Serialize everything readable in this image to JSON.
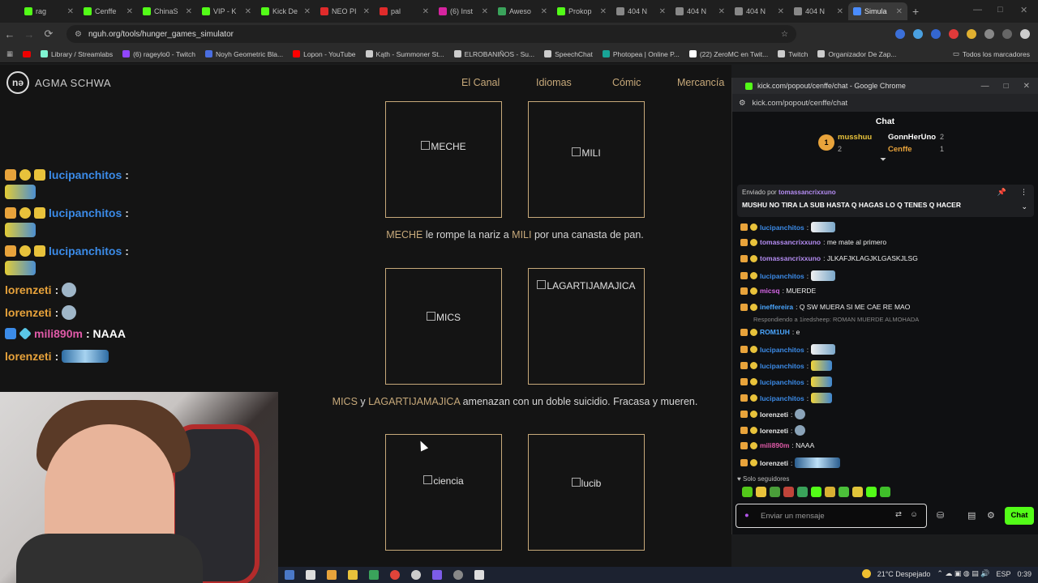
{
  "tabs": [
    {
      "title": "rag",
      "color": "#53fc18"
    },
    {
      "title": "Cenffe",
      "color": "#53fc18"
    },
    {
      "title": "ChinaS",
      "color": "#53fc18"
    },
    {
      "title": "VIP - K",
      "color": "#53fc18"
    },
    {
      "title": "Kick De",
      "color": "#53fc18"
    },
    {
      "title": "NEO PI",
      "color": "#e02b2b"
    },
    {
      "title": "pal",
      "color": "#e02b2b"
    },
    {
      "title": "(6) Inst",
      "color": "#d6249f"
    },
    {
      "title": "Aweso",
      "color": "#3aa35b"
    },
    {
      "title": "Prokop",
      "color": "#53fc18"
    },
    {
      "title": "404 N",
      "color": "#888"
    },
    {
      "title": "404 N",
      "color": "#888"
    },
    {
      "title": "404 N",
      "color": "#888"
    },
    {
      "title": "404 N",
      "color": "#888"
    },
    {
      "title": "Simula",
      "color": "#4a8cff"
    }
  ],
  "address": {
    "url": "nguh.org/tools/hunger_games_simulator"
  },
  "bookmarks": [
    {
      "label": "Library / Streamlabs",
      "color": "#80f5d2"
    },
    {
      "label": "(6) rageylo0 - Twitch",
      "color": "#9146ff"
    },
    {
      "label": "Noyh Geometric Bla...",
      "color": "#4a6ee0"
    },
    {
      "label": "Lopon - YouTube",
      "color": "#ff0000"
    },
    {
      "label": "Kąth - Summoner St...",
      "color": "#cccccc"
    },
    {
      "label": "ELROBANIÑOS - Su...",
      "color": "#cccccc"
    },
    {
      "label": "SpeechChat",
      "color": "#cccccc"
    },
    {
      "label": "Photopea | Online P...",
      "color": "#18a497"
    },
    {
      "label": "(22) ZeroMC en Twit...",
      "color": "#ffffff"
    },
    {
      "label": "Twitch",
      "color": "#cccccc"
    },
    {
      "label": "Organizador De Zap...",
      "color": "#cccccc"
    }
  ],
  "all_bookmarks": "Todos los marcadores",
  "site": {
    "logo": "nə",
    "brand": "AGMA SCHWA",
    "nav": [
      "El Canal",
      "Idiomas",
      "Cómic",
      "Mercancía"
    ],
    "cards": [
      "MECHE",
      "MILI",
      "MICS",
      "LAGARTIJAMAJICA",
      "ciencia",
      "lucib"
    ],
    "events": [
      {
        "a": "MECHE",
        "mid": " le rompe la nariz a ",
        "b": "MILI",
        "end": " por una canasta de pan."
      },
      {
        "a": "MICS",
        "mid": " y ",
        "b": "LAGARTIJAMAJICA",
        "end": " amenazan con un doble suicidio. Fracasa y mueren."
      }
    ]
  },
  "overlay_chat": [
    {
      "user": "lucipanchitos",
      "color": "#3b8be8",
      "text": ":"
    },
    {
      "user": "lucipanchitos",
      "color": "#3b8be8",
      "text": ":"
    },
    {
      "user": "lucipanchitos",
      "color": "#3b8be8",
      "text": ":"
    },
    {
      "user": "lorenzeti",
      "color": "#e8a33b",
      "text": ":"
    },
    {
      "user": "lorenzeti",
      "color": "#e8a33b",
      "text": ":"
    },
    {
      "user": "mili890m",
      "color": "#e05aa8",
      "text": ": NAAA"
    },
    {
      "user": "lorenzeti",
      "color": "#e8a33b",
      "text": ":"
    }
  ],
  "chat_window": {
    "title": "kick.com/popout/cenffe/chat - Google Chrome",
    "url": "kick.com/popout/cenffe/chat",
    "header": "Chat",
    "leaders": [
      {
        "name": "musshuu",
        "count": "2"
      },
      {
        "name": "GonnHerUno",
        "count": "2"
      },
      {
        "name": "Cenffe",
        "count": "1"
      }
    ],
    "pinned_by": "Enviado por",
    "pinned_user": "tomassancrixxuno",
    "pinned_text": "MUSHU NO TIRA LA SUB HASTA Q HAGAS LO Q TENES Q HACER",
    "messages": [
      {
        "user": "lucipanchitos",
        "color": "#3b8be8",
        "text": ":"
      },
      {
        "user": "tomassancrixxuno",
        "color": "#b48cf2",
        "text": ": me mate al primero"
      },
      {
        "user": "tomassancrixxuno",
        "color": "#b48cf2",
        "text": ": JLKAFJKLAGJKLGASKJLSG"
      },
      {
        "user": "lucipanchitos",
        "color": "#3b8be8",
        "text": ":"
      },
      {
        "user": "micsq",
        "color": "#d566e6",
        "text": ": MUERDE"
      },
      {
        "user": "ineffereira",
        "color": "#4aa6ff",
        "text": ": Q SW MUERA SI ME CAE RE MAO"
      },
      {
        "user": "ROM1UH",
        "color": "#4aa6ff",
        "text": ": e"
      },
      {
        "user": "lucipanchitos",
        "color": "#3b8be8",
        "text": ":"
      },
      {
        "user": "lucipanchitos",
        "color": "#3b8be8",
        "text": ":"
      },
      {
        "user": "lucipanchitos",
        "color": "#3b8be8",
        "text": ":"
      },
      {
        "user": "lucipanchitos",
        "color": "#3b8be8",
        "text": ":"
      },
      {
        "user": "lorenzeti",
        "color": "#e8e8e8",
        "text": ":"
      },
      {
        "user": "lorenzeti",
        "color": "#e8e8e8",
        "text": ":"
      },
      {
        "user": "mili890m",
        "color": "#e05aa8",
        "text": ": NAAA"
      },
      {
        "user": "lorenzeti",
        "color": "#e8e8e8",
        "text": ":"
      }
    ],
    "reply_note": "Respondiendo a 1iredsheep: ROMAN MUERDE ALMOHADA",
    "followers_only": "Solo seguidores",
    "input_placeholder": "Enviar un mensaje",
    "send_label": "Chat"
  },
  "taskbar": {
    "weather": "21°C Despejado",
    "lang": "ESP",
    "time": "0:39"
  }
}
